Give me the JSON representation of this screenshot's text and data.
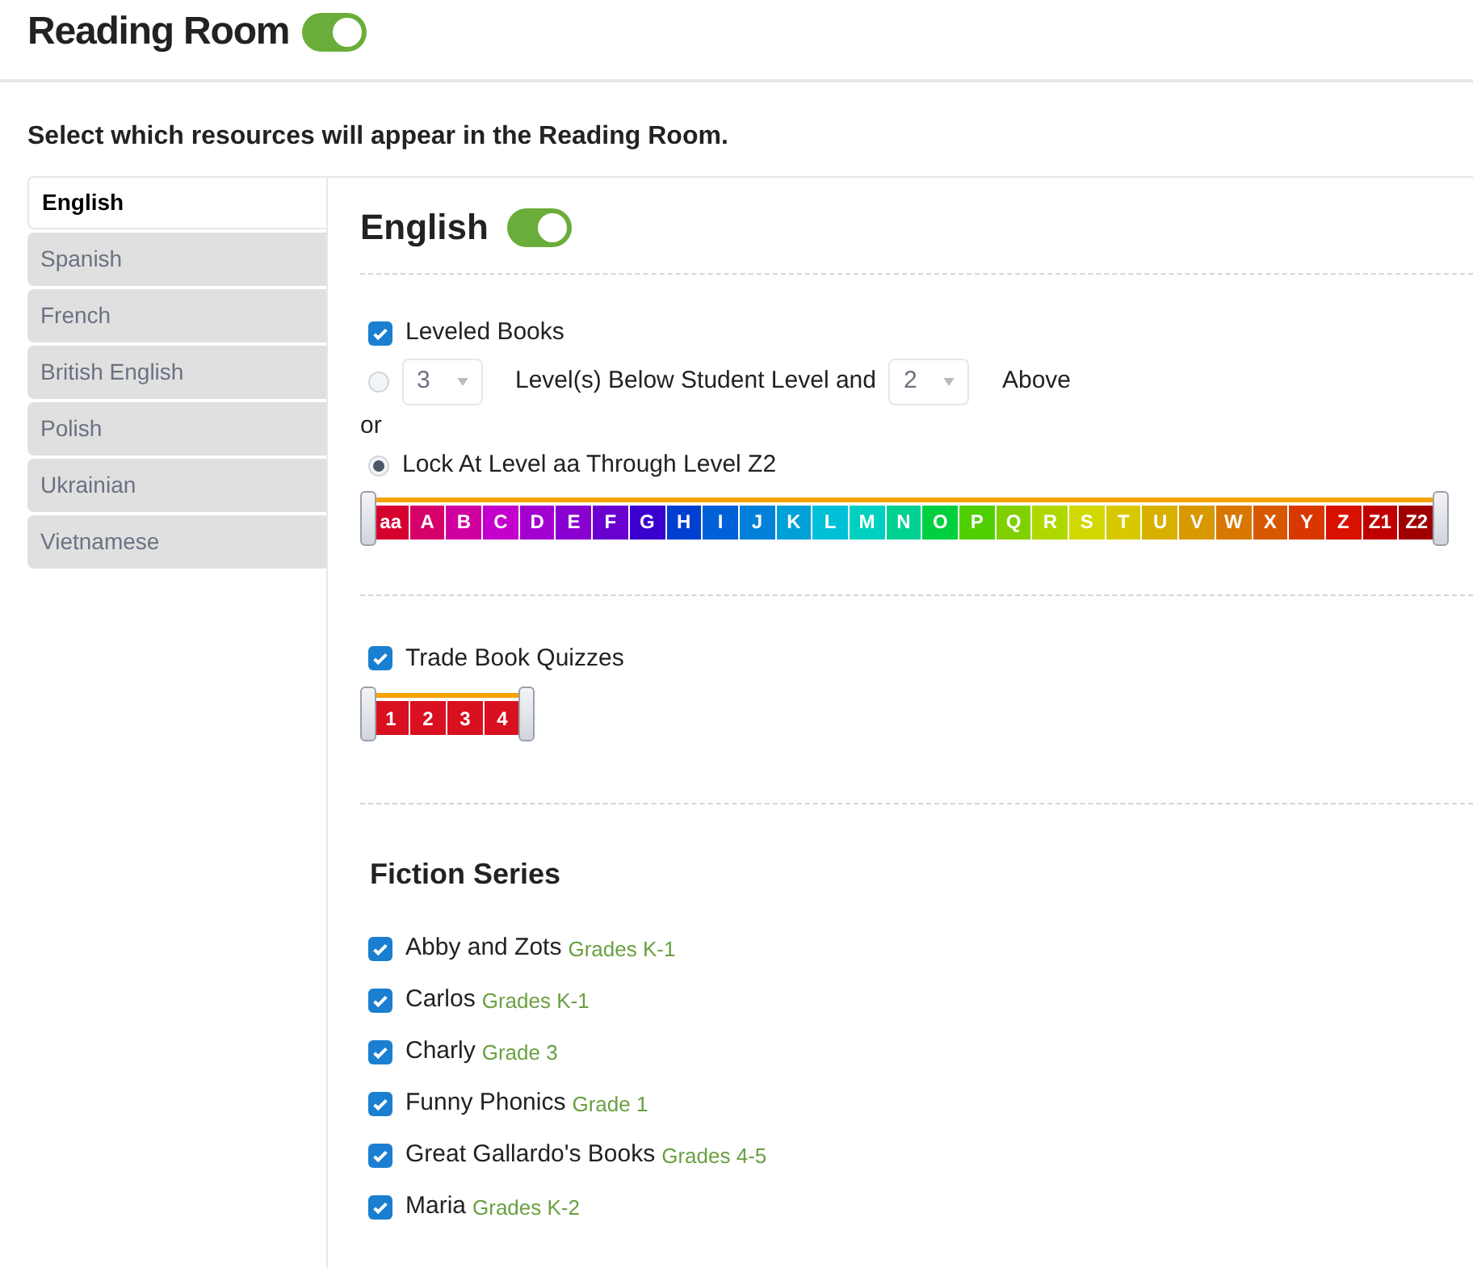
{
  "header": {
    "title": "Reading Room",
    "on": true
  },
  "instructions": "Select which resources will appear in the Reading Room.",
  "languages": [
    {
      "label": "English",
      "selected": true
    },
    {
      "label": "Spanish",
      "selected": false
    },
    {
      "label": "French",
      "selected": false
    },
    {
      "label": "British English",
      "selected": false
    },
    {
      "label": "Polish",
      "selected": false
    },
    {
      "label": "Ukrainian",
      "selected": false
    },
    {
      "label": "Vietnamese",
      "selected": false
    }
  ],
  "panel": {
    "title": "English",
    "on": true,
    "leveled_books": {
      "label": "Leveled Books",
      "checked": true,
      "relative": {
        "selected": false,
        "below": "3",
        "middle": "Level(s) Below Student Level and",
        "above": "2",
        "end": "Above"
      },
      "or": "or",
      "lock": {
        "selected": true,
        "label": "Lock At Level aa Through Level Z2"
      },
      "levels": [
        {
          "label": "aa",
          "color": "#d6002f"
        },
        {
          "label": "A",
          "color": "#d6006a"
        },
        {
          "label": "B",
          "color": "#d000a0"
        },
        {
          "label": "C",
          "color": "#c400cc"
        },
        {
          "label": "D",
          "color": "#a300d0"
        },
        {
          "label": "E",
          "color": "#8a00d0"
        },
        {
          "label": "F",
          "color": "#6a00d0"
        },
        {
          "label": "G",
          "color": "#3a00d0"
        },
        {
          "label": "H",
          "color": "#0040d0"
        },
        {
          "label": "I",
          "color": "#0060d8"
        },
        {
          "label": "J",
          "color": "#0080d8"
        },
        {
          "label": "K",
          "color": "#00a0d8"
        },
        {
          "label": "L",
          "color": "#00c0d8"
        },
        {
          "label": "M",
          "color": "#00d0c0"
        },
        {
          "label": "N",
          "color": "#00d090"
        },
        {
          "label": "O",
          "color": "#00d040"
        },
        {
          "label": "P",
          "color": "#50d000"
        },
        {
          "label": "Q",
          "color": "#80d000"
        },
        {
          "label": "R",
          "color": "#b0d800"
        },
        {
          "label": "S",
          "color": "#d0d800"
        },
        {
          "label": "T",
          "color": "#d8c800"
        },
        {
          "label": "U",
          "color": "#d8b000"
        },
        {
          "label": "V",
          "color": "#d89800"
        },
        {
          "label": "W",
          "color": "#d87800"
        },
        {
          "label": "X",
          "color": "#d85800"
        },
        {
          "label": "Y",
          "color": "#d83800"
        },
        {
          "label": "Z",
          "color": "#d81000"
        },
        {
          "label": "Z1",
          "color": "#c00000"
        },
        {
          "label": "Z2",
          "color": "#a00000"
        }
      ]
    },
    "trade_book_quizzes": {
      "label": "Trade Book Quizzes",
      "checked": true,
      "levels": [
        {
          "label": "1",
          "color": "#d81020"
        },
        {
          "label": "2",
          "color": "#d81020"
        },
        {
          "label": "3",
          "color": "#d81020"
        },
        {
          "label": "4",
          "color": "#d81020"
        }
      ]
    },
    "fiction_series": {
      "title": "Fiction Series",
      "items": [
        {
          "name": "Abby and Zots",
          "grades": "Grades K-1",
          "checked": true
        },
        {
          "name": "Carlos",
          "grades": "Grades K-1",
          "checked": true
        },
        {
          "name": "Charly",
          "grades": "Grade 3",
          "checked": true
        },
        {
          "name": "Funny Phonics",
          "grades": "Grade 1",
          "checked": true
        },
        {
          "name": "Great Gallardo's Books",
          "grades": "Grades 4-5",
          "checked": true
        },
        {
          "name": "Maria",
          "grades": "Grades K-2",
          "checked": true
        }
      ]
    }
  }
}
